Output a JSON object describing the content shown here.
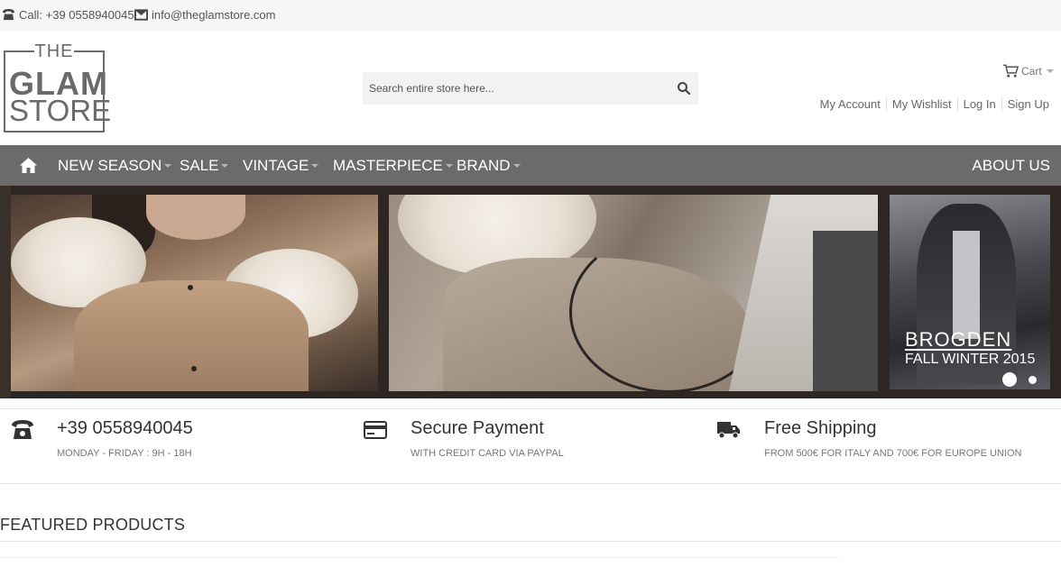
{
  "topbar": {
    "call": "Call: +39 0558940045",
    "email": "info@theglamstore.com"
  },
  "logo": {
    "line1": "THE",
    "line2": "GLAM",
    "line3": "STORE"
  },
  "search": {
    "placeholder": "Search entire store here..."
  },
  "header": {
    "cart_label": "Cart",
    "account_links": [
      "My Account",
      "My Wishlist",
      "Log In",
      "Sign Up"
    ]
  },
  "nav": {
    "items": [
      "NEW SEASON",
      "SALE",
      "VINTAGE",
      "MASTERPIECE",
      "BRAND"
    ],
    "about": "ABOUT US"
  },
  "hero": {
    "brand": "BROGDEN",
    "season": "FALL WINTER 2015",
    "slides": 2,
    "active_slide": 1
  },
  "features": [
    {
      "icon": "phone-icon",
      "title": "+39 0558940045",
      "subtitle": "MONDAY - FRIDAY : 9H - 18H"
    },
    {
      "icon": "credit-card-icon",
      "title": "Secure Payment",
      "subtitle": "WITH CREDIT CARD VIA PAYPAL"
    },
    {
      "icon": "truck-icon",
      "title": "Free Shipping",
      "subtitle": "FROM 500€ FOR ITALY AND 700€ FOR EUROPE UNION"
    }
  ],
  "featured": {
    "title": "FEATURED PRODUCTS"
  },
  "colors": {
    "nav_bg": "#6b6b6b",
    "topbar_bg": "#f6f6f6",
    "search_bg": "#f2f2f2"
  }
}
